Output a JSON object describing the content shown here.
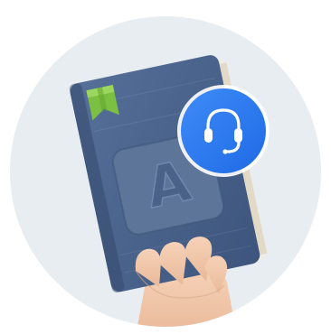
{
  "illustration": {
    "cover_letter": "A",
    "icons": {
      "badge": "headset-icon",
      "bookmark": "bookmark-icon"
    },
    "colors": {
      "background_circle": "#e8edf2",
      "book_cover": "#4a6288",
      "book_cover_dark": "#3a5075",
      "emblem": "#5d7598",
      "pages": "#f1ece0",
      "bookmark": "#7cc043",
      "badge": "#2f7cf2",
      "skin": "#f2c9ac"
    }
  }
}
